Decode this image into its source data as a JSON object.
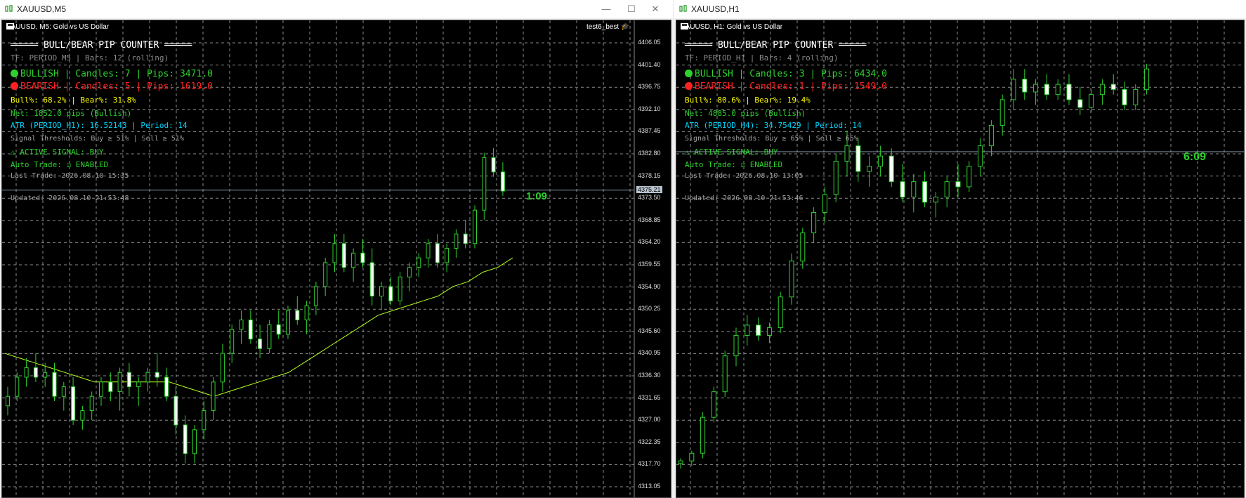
{
  "colors": {
    "bull": "#2ed12e",
    "bear": "#ff2020",
    "ma": "#b4ff20",
    "grid": "#8a8a8a",
    "bg": "#000000"
  },
  "left": {
    "window_title": "XAUUSD,M5",
    "symbol": "XAUUSD, M5:  Gold vs US Dollar",
    "expert": "test6_best",
    "panel": {
      "header": "═════ BULL/BEAR PIP COUNTER ═════",
      "subtitle": "TF: PERIOD_M5 | Bars: 12 (rolling)",
      "bullish": "BULLISH  |  Candles: 7  |  Pips: 3471.0",
      "bearish": "BEARISH  |  Candles: 5  |  Pips: 1619.0",
      "percent": "Bull%: 68.2%  |  Bear%: 31.8%",
      "net": "Net: 1852.0 pips (Bullish)",
      "atr": "ATR (PERIOD_H1): 16.52143 | Period: 14",
      "thresholds": "Signal Thresholds: Buy ≥ 51% | Sell ≥ 51%",
      "signal": "⚠ ACTIVE SIGNAL: BUY",
      "autotrade": "Auto Trade: ☑ ENABLED",
      "last_trade": "Last Trade: 2026.08.10 15:35",
      "updated": "Updated: 2026.08.10 21:53:48"
    },
    "price_labels": [
      "4406.05",
      "4401.40",
      "4396.75",
      "4392.10",
      "4387.45",
      "4382.80",
      "4378.15",
      "4373.50",
      "4368.85",
      "4364.20",
      "4359.55",
      "4354.90",
      "4350.25",
      "4345.60",
      "4340.95",
      "4336.30",
      "4331.65",
      "4327.00",
      "4322.35",
      "4317.70",
      "4313.05"
    ],
    "current_price": "4375.21",
    "timer": "1:09"
  },
  "right": {
    "window_title": "XAUUSD,H1",
    "symbol": "XAUUSD, H1:  Gold vs US Dollar",
    "panel": {
      "header": "═════ BULL/BEAR PIP COUNTER ═════",
      "subtitle": "TF: PERIOD_H1 | Bars: 4 (rolling)",
      "bullish": "BULLISH  |  Candles: 3  |  Pips: 6434.0",
      "bearish": "BEARISH  |  Candles: 1  |  Pips: 1549.0",
      "percent": "Bull%: 80.6%  |  Bear%: 19.4%",
      "net": "Net: 4885.0 pips (Bullish)",
      "atr": "ATR (PERIOD_H4): 34.75429 | Period: 14",
      "thresholds": "Signal Thresholds: Buy ≥ 65% | Sell ≥ 65%",
      "signal": "⚠ ACTIVE SIGNAL: BUY",
      "autotrade": "Auto Trade: ☑ ENABLED",
      "last_trade": "Last Trade: 2026.08.10 13:05",
      "updated": "Updated: 2026.08.10 21:53:46"
    },
    "timer": "6:09"
  },
  "window_controls": {
    "minimize": "—",
    "maximize": "☐",
    "close": "✕"
  },
  "candles_left": [
    [
      4330,
      4334,
      4328,
      4332
    ],
    [
      4332,
      4337,
      4331,
      4336
    ],
    [
      4336,
      4340,
      4334,
      4338
    ],
    [
      4338,
      4341,
      4335,
      4336
    ],
    [
      4336,
      4339,
      4334,
      4337
    ],
    [
      4337,
      4339,
      4331,
      4332
    ],
    [
      4332,
      4335,
      4329,
      4334
    ],
    [
      4334,
      4336,
      4326,
      4327
    ],
    [
      4327,
      4330,
      4325,
      4329
    ],
    [
      4329,
      4333,
      4327,
      4332
    ],
    [
      4332,
      4336,
      4330,
      4335
    ],
    [
      4335,
      4337,
      4331,
      4333
    ],
    [
      4333,
      4338,
      4329,
      4337
    ],
    [
      4337,
      4339,
      4332,
      4334
    ],
    [
      4334,
      4336,
      4330,
      4335
    ],
    [
      4335,
      4338,
      4333,
      4337
    ],
    [
      4337,
      4341,
      4334,
      4336
    ],
    [
      4336,
      4338,
      4331,
      4332
    ],
    [
      4332,
      4334,
      4324,
      4326
    ],
    [
      4326,
      4328,
      4318,
      4320
    ],
    [
      4320,
      4326,
      4318,
      4325
    ],
    [
      4325,
      4331,
      4323,
      4329
    ],
    [
      4329,
      4336,
      4327,
      4335
    ],
    [
      4335,
      4343,
      4333,
      4341
    ],
    [
      4341,
      4347,
      4339,
      4346
    ],
    [
      4346,
      4350,
      4343,
      4348
    ],
    [
      4348,
      4350,
      4343,
      4344
    ],
    [
      4344,
      4347,
      4340,
      4342
    ],
    [
      4342,
      4348,
      4341,
      4347
    ],
    [
      4347,
      4350,
      4344,
      4345
    ],
    [
      4345,
      4351,
      4344,
      4350
    ],
    [
      4350,
      4353,
      4347,
      4348
    ],
    [
      4348,
      4352,
      4345,
      4351
    ],
    [
      4351,
      4356,
      4349,
      4355
    ],
    [
      4355,
      4361,
      4353,
      4360
    ],
    [
      4360,
      4366,
      4358,
      4364
    ],
    [
      4364,
      4366,
      4358,
      4359
    ],
    [
      4359,
      4363,
      4356,
      4362
    ],
    [
      4362,
      4365,
      4359,
      4360
    ],
    [
      4360,
      4363,
      4351,
      4353
    ],
    [
      4353,
      4356,
      4350,
      4355
    ],
    [
      4355,
      4357,
      4351,
      4352
    ],
    [
      4352,
      4358,
      4351,
      4357
    ],
    [
      4357,
      4360,
      4354,
      4359
    ],
    [
      4359,
      4362,
      4357,
      4361
    ],
    [
      4361,
      4365,
      4359,
      4364
    ],
    [
      4364,
      4366,
      4359,
      4360
    ],
    [
      4360,
      4364,
      4358,
      4363
    ],
    [
      4363,
      4367,
      4361,
      4366
    ],
    [
      4366,
      4369,
      4363,
      4364
    ],
    [
      4364,
      4372,
      4363,
      4371
    ],
    [
      4371,
      4383,
      4369,
      4382
    ],
    [
      4382,
      4384,
      4378,
      4379
    ],
    [
      4379,
      4381,
      4374,
      4375
    ]
  ],
  "ma_left": [
    4341,
    4340,
    4339,
    4338,
    4337,
    4336,
    4335,
    4335,
    4335,
    4335,
    4335,
    4335,
    4334,
    4333,
    4332,
    4333,
    4334,
    4335,
    4336,
    4337,
    4339,
    4341,
    4343,
    4345,
    4347,
    4349,
    4350,
    4351,
    4352,
    4353,
    4355,
    4356,
    4358,
    4359,
    4361
  ],
  "candles_right": [
    [
      4328,
      4330,
      4326,
      4329
    ],
    [
      4329,
      4333,
      4327,
      4332
    ],
    [
      4332,
      4348,
      4330,
      4346
    ],
    [
      4346,
      4358,
      4344,
      4356
    ],
    [
      4356,
      4372,
      4354,
      4370
    ],
    [
      4370,
      4381,
      4366,
      4378
    ],
    [
      4378,
      4386,
      4374,
      4382
    ],
    [
      4382,
      4385,
      4376,
      4378
    ],
    [
      4378,
      4383,
      4375,
      4381
    ],
    [
      4381,
      4395,
      4379,
      4393
    ],
    [
      4393,
      4410,
      4390,
      4407
    ],
    [
      4407,
      4420,
      4404,
      4418
    ],
    [
      4418,
      4428,
      4414,
      4426
    ],
    [
      4426,
      4436,
      4422,
      4433
    ],
    [
      4433,
      4449,
      4430,
      4446
    ],
    [
      4446,
      4458,
      4440,
      4452
    ],
    [
      4452,
      4455,
      4438,
      4442
    ],
    [
      4442,
      4448,
      4436,
      4444
    ],
    [
      4444,
      4452,
      4440,
      4448
    ],
    [
      4448,
      4451,
      4436,
      4438
    ],
    [
      4438,
      4445,
      4430,
      4432
    ],
    [
      4432,
      4441,
      4426,
      4438
    ],
    [
      4438,
      4442,
      4428,
      4430
    ],
    [
      4430,
      4434,
      4424,
      4432
    ],
    [
      4432,
      4440,
      4428,
      4438
    ],
    [
      4438,
      4445,
      4432,
      4436
    ],
    [
      4436,
      4446,
      4434,
      4444
    ],
    [
      4444,
      4455,
      4440,
      4452
    ],
    [
      4452,
      4462,
      4448,
      4460
    ],
    [
      4460,
      4472,
      4456,
      4470
    ],
    [
      4470,
      4482,
      4466,
      4478
    ],
    [
      4478,
      4482,
      4470,
      4473
    ],
    [
      4473,
      4478,
      4468,
      4476
    ],
    [
      4476,
      4480,
      4470,
      4472
    ],
    [
      4472,
      4478,
      4470,
      4476
    ],
    [
      4476,
      4480,
      4468,
      4470
    ],
    [
      4470,
      4475,
      4464,
      4467
    ],
    [
      4467,
      4474,
      4465,
      4472
    ],
    [
      4472,
      4478,
      4468,
      4476
    ],
    [
      4476,
      4480,
      4472,
      4474
    ],
    [
      4474,
      4477,
      4466,
      4468
    ],
    [
      4468,
      4476,
      4466,
      4474
    ],
    [
      4474,
      4484,
      4472,
      4482
    ]
  ]
}
